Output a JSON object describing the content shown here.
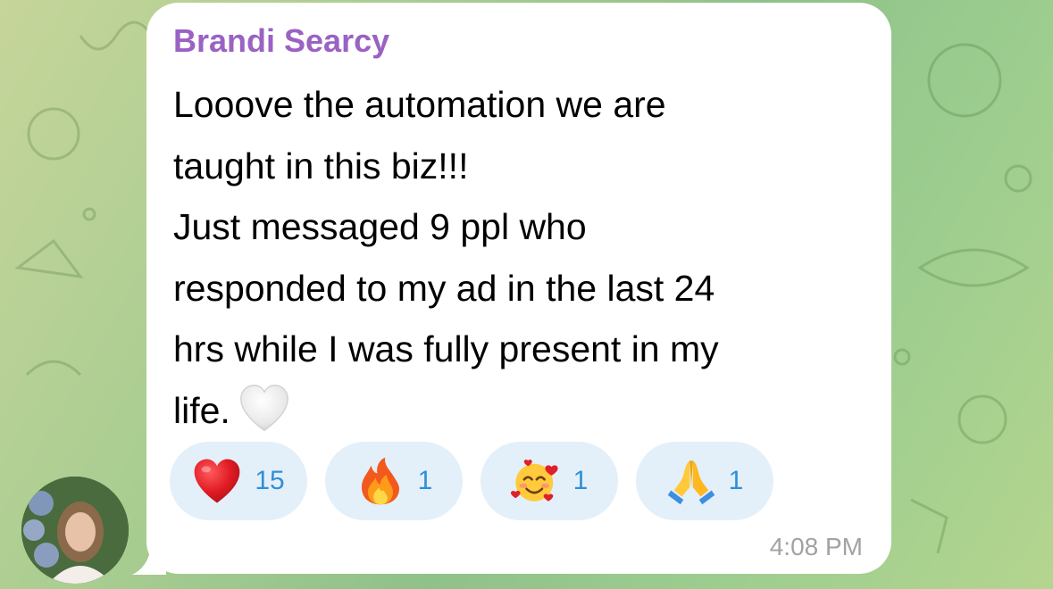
{
  "message": {
    "sender_name": "Brandi Searcy",
    "text_lines": [
      "Looove the automation we are",
      "taught in this biz!!!",
      "Just messaged 9 ppl who",
      "responded to my ad in the last 24",
      "hrs while I was fully present in my",
      "life."
    ],
    "inline_emoji": "white-heart-icon",
    "time": "4:08 PM"
  },
  "reactions": [
    {
      "icon": "red-heart-icon",
      "count": "15"
    },
    {
      "icon": "fire-icon",
      "count": "1"
    },
    {
      "icon": "smiling-face-with-hearts-icon",
      "count": "1"
    },
    {
      "icon": "folded-hands-icon",
      "count": "1"
    }
  ],
  "avatar": {
    "icon": "user-avatar"
  },
  "colors": {
    "sender_name": "#9a62c4",
    "reaction_bg": "#e3f0fa",
    "reaction_count": "#2f8fd8",
    "timestamp": "#a2a2a2",
    "bubble_bg": "#ffffff"
  }
}
